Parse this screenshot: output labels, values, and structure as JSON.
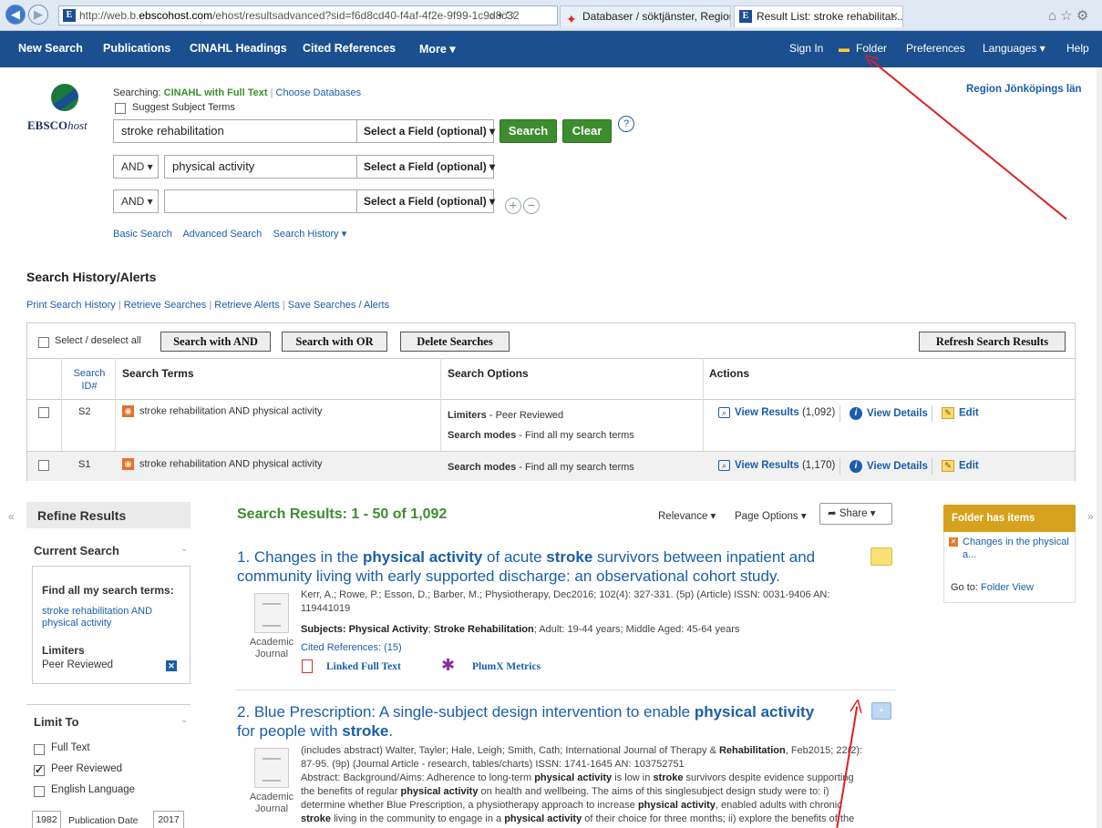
{
  "browser": {
    "url_prefix": "http://web.b.",
    "url_domain": "ebscohost.com",
    "url_suffix": "/ehost/resultsadvanced?sid=f6d8cd40-f4af-4f2e-9f99-1c9d8c32",
    "tab1": "Databaser / söktjänster, Region...",
    "tab2": "Result List: stroke rehabilitat..."
  },
  "nav": {
    "new_search": "New Search",
    "publications": "Publications",
    "cinahl": "CINAHL Headings",
    "cited": "Cited References",
    "more": "More ▾",
    "sign_in": "Sign In",
    "folder": "Folder",
    "preferences": "Preferences",
    "languages": "Languages ▾",
    "help": "Help"
  },
  "search": {
    "logo_text": "EBSCO",
    "logo_host": "host",
    "searching_label": "Searching:",
    "database": "CINAHL with Full Text",
    "choose_db": "Choose Databases",
    "suggest": "Suggest Subject Terms",
    "institution": "Region Jönköpings län",
    "row1_value": "stroke rehabilitation",
    "row2_value": "physical activity",
    "row3_value": "",
    "field_label": "Select a Field (optional) ▾",
    "and_label": "AND ▾",
    "search_btn": "Search",
    "clear_btn": "Clear",
    "help_q": "?",
    "basic": "Basic Search",
    "advanced": "Advanced Search",
    "history": "Search History ▾"
  },
  "history": {
    "heading": "Search History/Alerts",
    "print": "Print Search History",
    "retrieve_searches": "Retrieve Searches",
    "retrieve_alerts": "Retrieve Alerts",
    "save": "Save Searches / Alerts",
    "select_all": "Select / deselect all",
    "btn_and": "Search with AND",
    "btn_or": "Search with OR",
    "btn_delete": "Delete Searches",
    "btn_refresh": "Refresh Search Results",
    "col_id_1": "Search",
    "col_id_2": "ID#",
    "col_terms": "Search Terms",
    "col_options": "Search Options",
    "col_actions": "Actions",
    "rows": [
      {
        "id": "S2",
        "terms": "stroke rehabilitation AND physical activity",
        "limiters_label": "Limiters",
        "limiters_value": " - Peer Reviewed",
        "modes_label": "Search modes",
        "modes_value": " - Find all my search terms",
        "view": "View Results",
        "count": " (1,092)",
        "details": "View Details",
        "edit": "Edit"
      },
      {
        "id": "S1",
        "terms": "stroke rehabilitation AND physical activity",
        "modes_label": "Search modes",
        "modes_value": " - Find all my search terms",
        "view": "View Results",
        "count": " (1,170)",
        "details": "View Details",
        "edit": "Edit"
      }
    ]
  },
  "refine": {
    "title": "Refine Results",
    "current": "Current Search",
    "find_all": "Find all my search terms:",
    "query": "stroke rehabilitation AND physical activity",
    "limiters": "Limiters",
    "peer": "Peer Reviewed",
    "limit_to": "Limit To",
    "full_text": "Full Text",
    "peer_reviewed": "Peer Reviewed",
    "english": "English Language",
    "date_from": "1982",
    "date_label": "Publication Date",
    "date_to": "2017"
  },
  "results": {
    "heading": "Search Results: 1 - 50 of 1,092",
    "relevance": "Relevance ▾",
    "page_options": "Page Options ▾",
    "share": "Share ▾",
    "r1": {
      "t1": "1. Changes in the ",
      "t2": "physical activity",
      "t3": " of acute ",
      "t4": "stroke",
      "t5": " survivors between inpatient and",
      "t6": "community living with early supported discharge: an observational cohort study.",
      "meta1": "Kerr, A.; Rowe, P.; Esson, D.; Barber, M.; Physiotherapy, Dec2016; 102(4): 327-331. (5p) (Article) ISSN: 0031-9406 AN:",
      "meta2": "119441019",
      "subjects_label": "Subjects: ",
      "subj1": "Physical Activity",
      "subj_sep": "; ",
      "subj2": "Stroke Rehabilitation",
      "subj_rest": "; Adult: 19-44 years; Middle Aged: 45-64 years",
      "cited": "Cited References: (15)",
      "linked": "Linked Full Text",
      "plumx": "PlumX Metrics",
      "type1": "Academic",
      "type2": "Journal"
    },
    "r2": {
      "t1": "2. Blue Prescription: A single-subject design intervention to enable ",
      "t2": "physical activity",
      "t3": "for people with ",
      "t4": "stroke",
      "t5": ".",
      "m1a": "(includes abstract) Walter, Tayler; Hale, Leigh; Smith, Cath; International Journal of Therapy & ",
      "m1b": "Rehabilitation",
      "m1c": ", Feb2015; 22(2):",
      "m2": "87-95. (9p) (Journal Article - research, tables/charts) ISSN: 1741-1645 AN: 103752751",
      "m3a": "Abstract: Background/Aims: Adherence to long-term ",
      "m3b": "physical activity",
      "m3c": " is low in ",
      "m3d": "stroke",
      "m3e": " survivors despite evidence supporting",
      "m4a": "the benefits of regular ",
      "m4b": "physical activity",
      "m4c": " on health and wellbeing. The aims of this singlesubject design study were to: i)",
      "m5a": "determine whether Blue Prescription, a physiotherapy approach to increase ",
      "m5b": "physical activity",
      "m5c": ", enabled adults with chronic",
      "m6a": "stroke",
      "m6b": " living in the community to engage in a ",
      "m6c": "physical activity",
      "m6d": " of their choice for three months; ii) explore the benefits of the",
      "type1": "Academic",
      "type2": "Journal"
    }
  },
  "folder_panel": {
    "title": "Folder has items",
    "item": "Changes in the physical a...",
    "goto": "Go to: ",
    "view": "Folder View"
  },
  "colors": {
    "nav": "#1b4f8f",
    "link": "#1a5ea8",
    "green": "#3d8d2f",
    "folder": "#d6a21d",
    "annotation": "#e02020"
  }
}
